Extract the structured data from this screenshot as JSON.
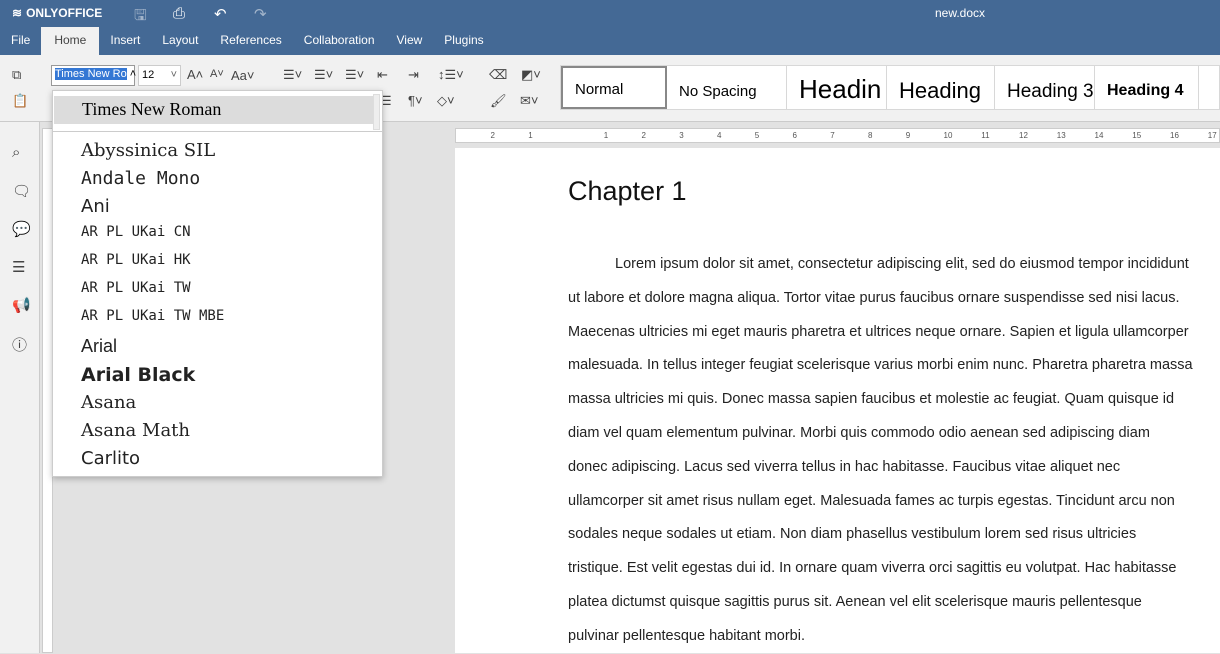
{
  "app": {
    "name": "ONLYOFFICE",
    "document_title": "new.docx"
  },
  "tabs": [
    "File",
    "Home",
    "Insert",
    "Layout",
    "References",
    "Collaboration",
    "View",
    "Plugins"
  ],
  "toolbar": {
    "font_name": "Times New Ro",
    "font_size": "12",
    "styles": [
      "Normal",
      "No Spacing",
      "Headin",
      "Heading",
      "Heading 3",
      "Heading 4"
    ]
  },
  "font_dropdown": {
    "selected": "Times New Roman",
    "items": [
      "Abyssinica SIL",
      "Andale Mono",
      "Ani",
      "AR PL UKai CN",
      "AR PL UKai HK",
      "AR PL UKai TW",
      "AR PL UKai TW MBE",
      "Arial",
      "Arial Black",
      "Asana",
      "Asana Math",
      "Carlito"
    ]
  },
  "ruler": [
    "2",
    "1",
    "1",
    "2",
    "3",
    "4",
    "5",
    "6",
    "7",
    "8",
    "9",
    "10",
    "11",
    "12",
    "13",
    "14",
    "15",
    "16",
    "17"
  ],
  "document": {
    "heading": "Chapter 1",
    "paragraph": "Lorem ipsum dolor sit amet, consectetur adipiscing elit, sed do eiusmod tempor incididunt ut labore et dolore magna aliqua. Tortor vitae purus faucibus ornare suspendisse sed nisi lacus. Maecenas ultricies mi eget mauris pharetra et ultrices neque ornare. Sapien et ligula ullamcorper malesuada. In tellus integer feugiat scelerisque varius morbi enim nunc. Pharetra pharetra massa massa ultricies mi quis. Donec massa sapien faucibus et molestie ac feugiat. Quam quisque id diam vel quam elementum pulvinar. Morbi quis commodo odio aenean sed adipiscing diam donec adipiscing. Lacus sed viverra tellus in hac habitasse. Faucibus vitae aliquet nec ullamcorper sit amet risus nullam eget. Malesuada fames ac turpis egestas. Tincidunt arcu non sodales neque sodales ut etiam. Non diam phasellus vestibulum lorem sed risus ultricies tristique. Est velit egestas dui id. In ornare quam viverra orci sagittis eu volutpat. Hac habitasse platea dictumst quisque sagittis purus sit. Aenean vel elit scelerisque mauris pellentesque pulvinar pellentesque habitant morbi."
  },
  "colors": {
    "header": "#446995",
    "selection": "#3477d4"
  }
}
